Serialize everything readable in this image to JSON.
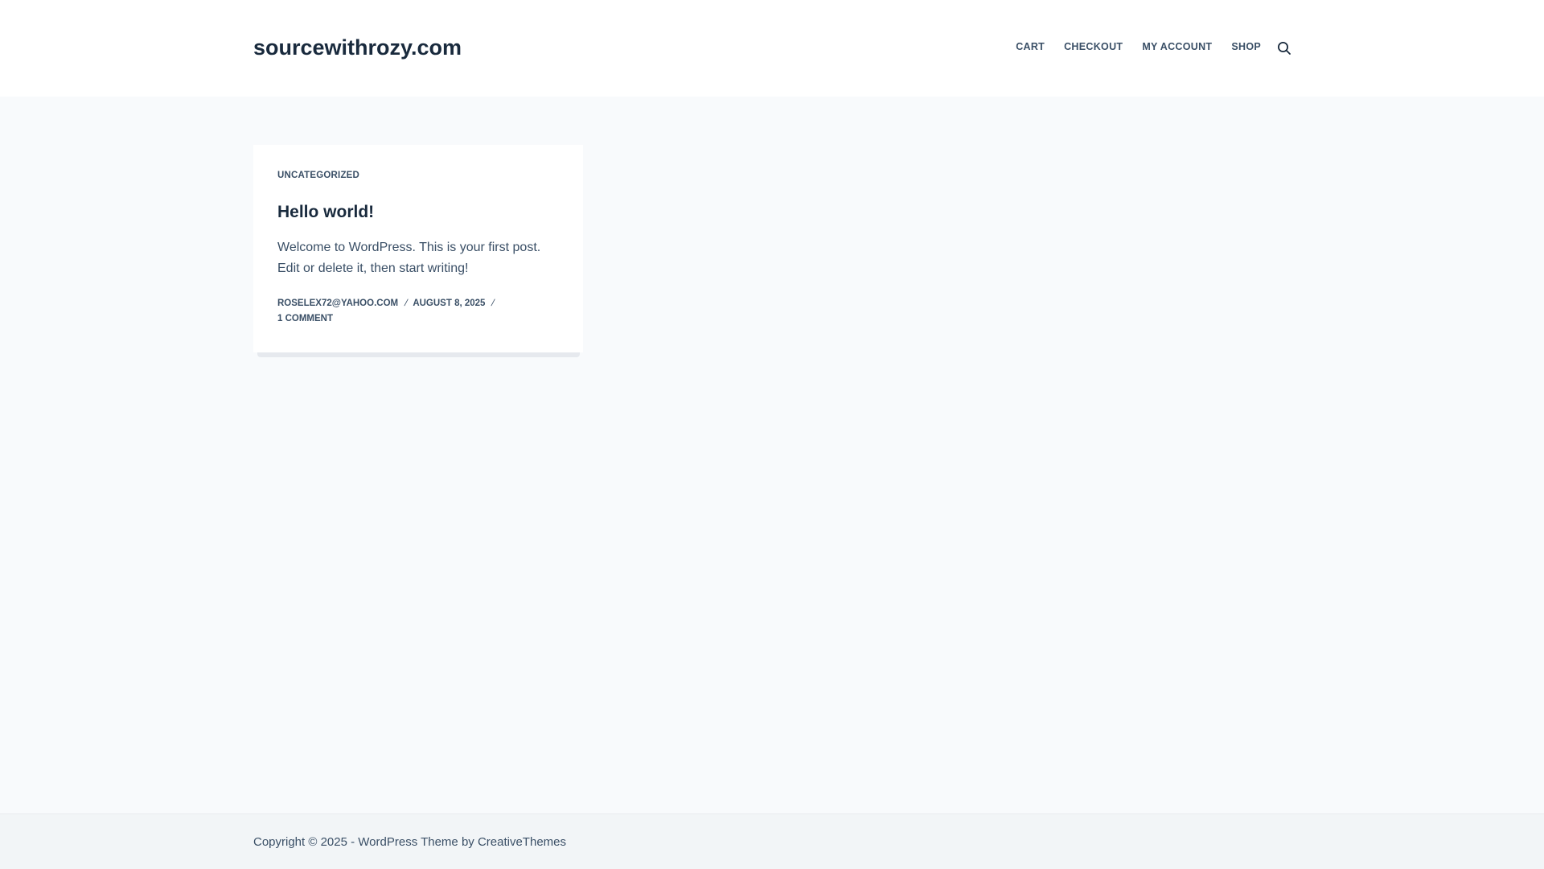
{
  "header": {
    "site_title": "sourcewithrozy.com",
    "nav": [
      {
        "label": "CART"
      },
      {
        "label": "CHECKOUT"
      },
      {
        "label": "MY ACCOUNT"
      },
      {
        "label": "SHOP"
      }
    ],
    "search_icon": "search-icon"
  },
  "post": {
    "category": "UNCATEGORIZED",
    "title": "Hello world!",
    "excerpt": "Welcome to WordPress. This is your first post. Edit or delete it, then start writing!",
    "author": "ROSELEX72@YAHOO.COM",
    "date": "AUGUST 8, 2025",
    "comments": "1 COMMENT",
    "meta_separator": "/"
  },
  "footer": {
    "copyright_prefix": "Copyright © 2025 - WordPress Theme by ",
    "theme_author": "CreativeThemes"
  },
  "colors": {
    "background": "#f8fafc",
    "header_bg": "#ffffff",
    "heading": "#192a3d",
    "text": "#3a4f66",
    "footer_bg": "#f2f5f7"
  }
}
